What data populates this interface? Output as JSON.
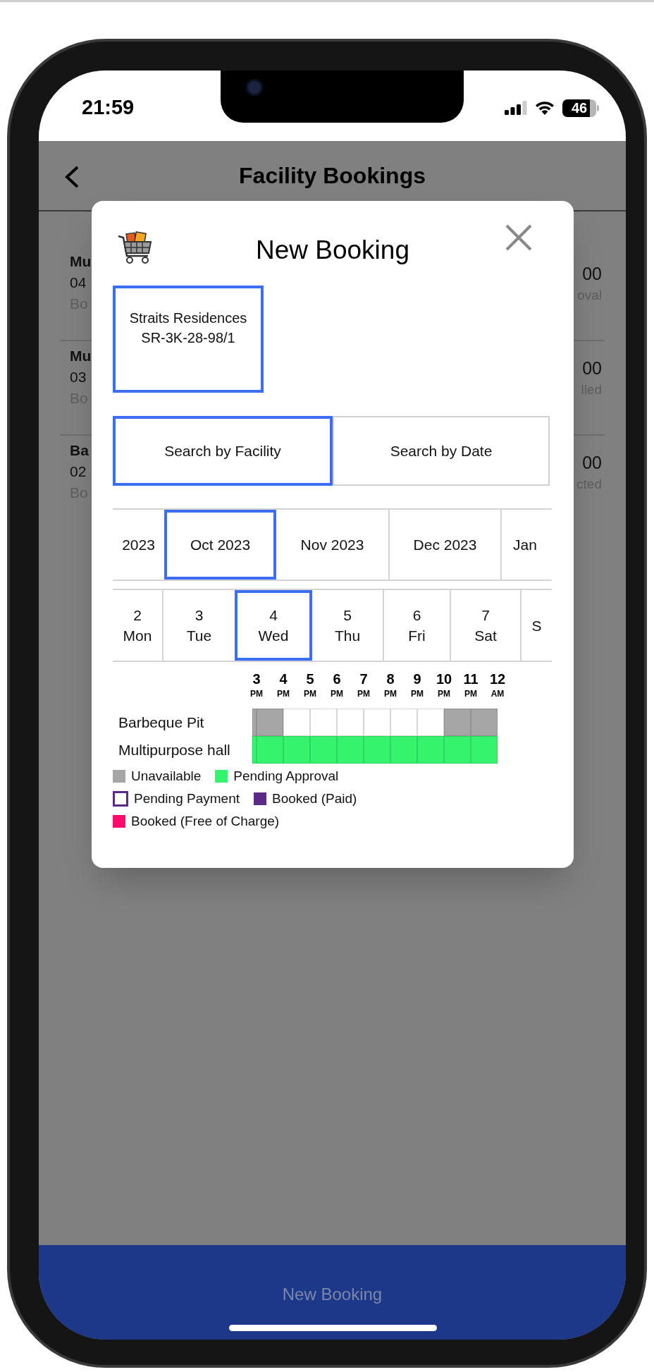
{
  "status_bar": {
    "time": "21:59",
    "battery": "46"
  },
  "header": {
    "title": "Facility Bookings"
  },
  "bookings": [
    {
      "name": "Mu",
      "date": "04",
      "note": "Bo",
      "amount": "00",
      "status": "oval"
    },
    {
      "name": "Mu",
      "date": "03",
      "note": "Bo",
      "amount": "00",
      "status": "lled"
    },
    {
      "name": "Ba",
      "date": "02",
      "note": "Bo",
      "amount": "00",
      "status": "cted"
    }
  ],
  "modal": {
    "title": "New Booking",
    "property": {
      "name": "Straits Residences",
      "unit": "SR-3K-28-98/1"
    },
    "search_tabs": [
      {
        "label": "Search by Facility",
        "selected": true
      },
      {
        "label": "Search by Date",
        "selected": false
      }
    ],
    "months": [
      {
        "label": "2023",
        "selected": false
      },
      {
        "label": "Oct 2023",
        "selected": true
      },
      {
        "label": "Nov 2023",
        "selected": false
      },
      {
        "label": "Dec 2023",
        "selected": false
      },
      {
        "label": "Jan",
        "selected": false
      }
    ],
    "days": [
      {
        "day": "2",
        "weekday": "Mon",
        "selected": false
      },
      {
        "day": "3",
        "weekday": "Tue",
        "selected": false
      },
      {
        "day": "4",
        "weekday": "Wed",
        "selected": true
      },
      {
        "day": "5",
        "weekday": "Thu",
        "selected": false
      },
      {
        "day": "6",
        "weekday": "Fri",
        "selected": false
      },
      {
        "day": "7",
        "weekday": "Sat",
        "selected": false
      },
      {
        "weekday": "S",
        "selected": false
      }
    ],
    "time_headers": [
      {
        "hour": "3",
        "period": "PM"
      },
      {
        "hour": "4",
        "period": "PM"
      },
      {
        "hour": "5",
        "period": "PM"
      },
      {
        "hour": "6",
        "period": "PM"
      },
      {
        "hour": "7",
        "period": "PM"
      },
      {
        "hour": "8",
        "period": "PM"
      },
      {
        "hour": "9",
        "period": "PM"
      },
      {
        "hour": "10",
        "period": "PM"
      },
      {
        "hour": "11",
        "period": "PM"
      },
      {
        "hour": "12",
        "period": "AM"
      }
    ],
    "facilities": [
      {
        "name": "Barbeque Pit",
        "slots": [
          {
            "kind": "unavailable"
          },
          {
            "kind": "unavailable"
          },
          {
            "kind": "free"
          },
          {
            "kind": "free"
          },
          {
            "kind": "free"
          },
          {
            "kind": "free"
          },
          {
            "kind": "free"
          },
          {
            "kind": "free"
          },
          {
            "kind": "unavailable"
          },
          {
            "kind": "unavailable"
          }
        ]
      },
      {
        "name": "Multipurpose hall",
        "slots": [
          {
            "kind": "pending"
          },
          {
            "kind": "pending"
          },
          {
            "kind": "pending"
          },
          {
            "kind": "pending"
          },
          {
            "kind": "pending"
          },
          {
            "kind": "pending"
          },
          {
            "kind": "pending"
          },
          {
            "kind": "pending"
          },
          {
            "kind": "pending"
          },
          {
            "kind": "pending"
          }
        ]
      }
    ],
    "legend": [
      {
        "label": "Unavailable",
        "kind": "fill",
        "color": "#a6a6a6"
      },
      {
        "label": "Pending Approval",
        "kind": "fill",
        "color": "#35f36d"
      },
      {
        "label": "Pending Payment",
        "kind": "outline",
        "color": "#5b2a86"
      },
      {
        "label": "Booked (Paid)",
        "kind": "fill",
        "color": "#5b2a86"
      },
      {
        "label": "Booked (Free of Charge)",
        "kind": "fill",
        "color": "#ff0a6c"
      }
    ]
  },
  "bottom_bar": {
    "button": "New Booking"
  }
}
